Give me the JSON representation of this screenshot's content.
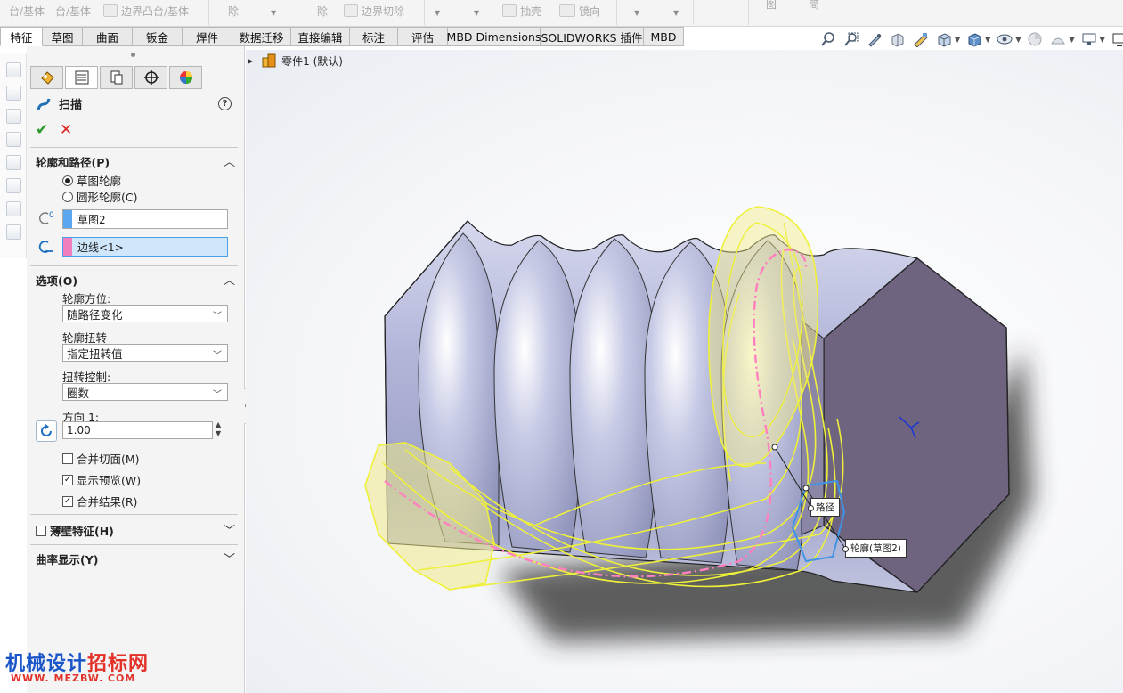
{
  "toolbar": {
    "items": [
      {
        "label": "台/基体",
        "icon": "revolve-boss-icon"
      },
      {
        "label": "台/基体",
        "icon": "swept-boss-icon"
      },
      {
        "label": "边界凸台/基体",
        "icon": "boundary-boss-icon"
      },
      {
        "label": "除",
        "icon": "cut-icon"
      },
      {
        "label": "除",
        "icon": "swept-cut-icon"
      },
      {
        "label": "边界切除",
        "icon": "boundary-cut-icon"
      },
      {
        "label": "抽壳",
        "icon": "shell-icon"
      },
      {
        "label": "镜向",
        "icon": "mirror-icon"
      },
      {
        "label": "图",
        "icon": "reference-icon"
      },
      {
        "label": "简",
        "icon": "curves-icon"
      }
    ]
  },
  "tabs": [
    {
      "label": "特征",
      "active": true
    },
    {
      "label": "草图"
    },
    {
      "label": "曲面"
    },
    {
      "label": "钣金"
    },
    {
      "label": "焊件"
    },
    {
      "label": "数据迁移"
    },
    {
      "label": "直接编辑"
    },
    {
      "label": "标注"
    },
    {
      "label": "评估"
    },
    {
      "label": "MBD Dimensions"
    },
    {
      "label": "SOLIDWORKS 插件"
    },
    {
      "label": "MBD"
    }
  ],
  "view_toolbar": {
    "icons": [
      "zoom-to-fit-icon",
      "zoom-to-area-icon",
      "previous-view-icon",
      "section-view-icon",
      "dynamic-annotation-icon",
      "view-orientation-icon",
      "display-style-icon",
      "hide-show-items-icon",
      "edit-appearance-icon",
      "apply-scene-icon",
      "view-settings-icon",
      "monitor-icon"
    ]
  },
  "property_manager": {
    "title": "扫描",
    "help_symbol": "?",
    "ok_symbol": "✔",
    "cancel_symbol": "✕",
    "profile_path_group": {
      "header": "轮廓和路径(P)",
      "radio_sketch_profile": "草图轮廓",
      "radio_circular_profile": "圆形轮廓(C)",
      "selected_radio": "草图轮廓",
      "profile_value": "草图2",
      "profile_color": "#5aa7f0",
      "path_value": "边线<1>",
      "path_color": "#f07fbf"
    },
    "options_group": {
      "header": "选项(O)",
      "orientation_label": "轮廓方位:",
      "orientation_value": "随路径变化",
      "twist_label": "轮廓扭转",
      "twist_value": "指定扭转值",
      "twist_control_label": "扭转控制:",
      "twist_control_value": "圈数",
      "direction_label": "方向 1:",
      "direction_value": "1.00",
      "merge_tangent_faces": {
        "label": "合并切面(M)",
        "checked": false
      },
      "show_preview": {
        "label": "显示预览(W)",
        "checked": true
      },
      "merge_result": {
        "label": "合并结果(R)",
        "checked": true
      }
    },
    "thin_feature": {
      "label": "薄壁特征(H)",
      "checked": false
    },
    "curvature_display": {
      "header": "曲率显示(Y)"
    }
  },
  "feature_tree": {
    "label": "零件1  (默认)"
  },
  "viewport": {
    "callout_path": "路径",
    "callout_profile": "轮廓(草图2)",
    "colors": {
      "body": "#b9bde0",
      "hex_face": "#6e6480",
      "preview": "#f2ef2a",
      "path": "#ff7fbf",
      "profile": "#3f94e6"
    }
  },
  "watermark": {
    "line1_a": "机械设计",
    "line1_b": "招标网",
    "line2": "WWW. MEZBW. COM"
  }
}
